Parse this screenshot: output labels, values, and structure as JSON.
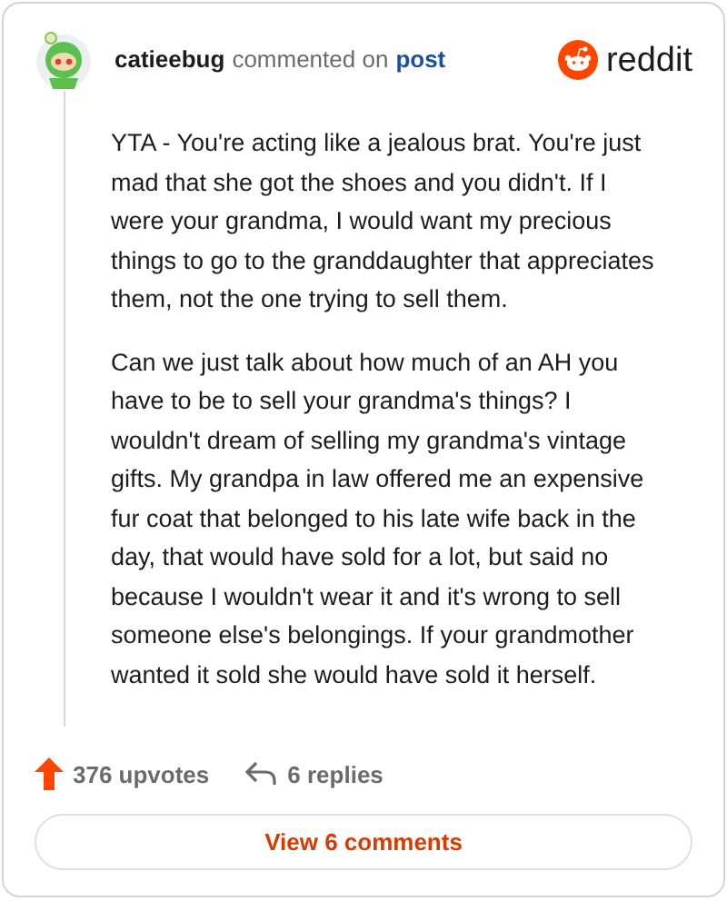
{
  "header": {
    "username": "catieebug",
    "action": "commented on",
    "link": "post",
    "brand": "reddit"
  },
  "paragraphs": [
    "YTA - You're acting like a jealous brat. You're just mad that she got the shoes and you didn't. If I were your grandma, I would want my precious things to go to the granddaughter that appreciates them, not the one trying to sell them.",
    "Can we just talk about how much of an AH you have to be to sell your grandma's things? I wouldn't dream of selling my grandma's vintage gifts. My grandpa in law offered me an expensive fur coat that belonged to his late wife back in the day, that would have sold for a lot, but said no because I wouldn't wear it and it's wrong to sell someone else's belongings. If your grandmother wanted it sold she would have sold it herself."
  ],
  "stats": {
    "upvotes": "376 upvotes",
    "replies": "6 replies"
  },
  "button": "View 6 comments"
}
